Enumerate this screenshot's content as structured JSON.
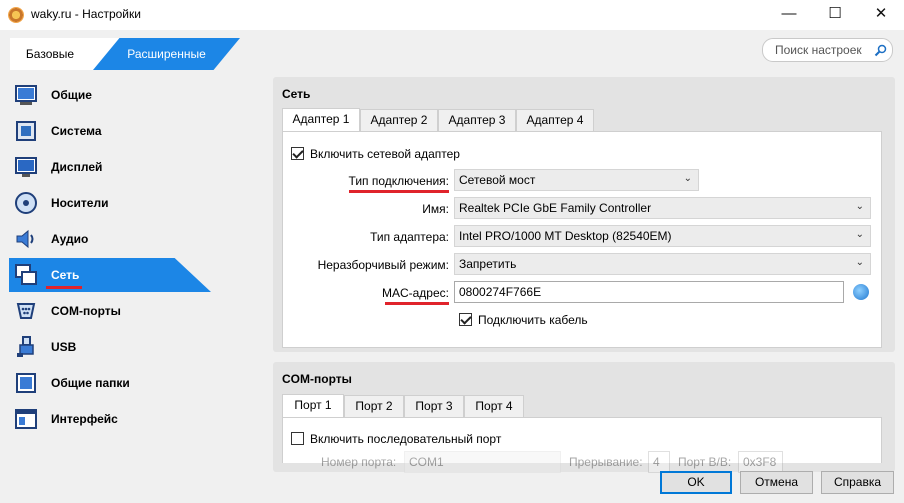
{
  "window": {
    "title": "waky.ru - Настройки",
    "controls": {
      "minimize": "—",
      "maximize": "☐",
      "close": "✕"
    }
  },
  "mode_tabs": {
    "basic": "Базовые",
    "advanced": "Расширенные",
    "active": "advanced"
  },
  "search": {
    "placeholder": "Поиск настроек",
    "icon": "search-icon"
  },
  "sidebar": {
    "items": [
      {
        "label": "Общие",
        "icon": "general-icon"
      },
      {
        "label": "Система",
        "icon": "system-icon"
      },
      {
        "label": "Дисплей",
        "icon": "display-icon"
      },
      {
        "label": "Носители",
        "icon": "storage-icon"
      },
      {
        "label": "Аудио",
        "icon": "audio-icon"
      },
      {
        "label": "Сеть",
        "icon": "network-icon",
        "active": true
      },
      {
        "label": "COM-порты",
        "icon": "serial-ports-icon"
      },
      {
        "label": "USB",
        "icon": "usb-icon"
      },
      {
        "label": "Общие папки",
        "icon": "shared-folders-icon"
      },
      {
        "label": "Интерфейс",
        "icon": "user-interface-icon"
      }
    ]
  },
  "network": {
    "title": "Сеть",
    "tabs": [
      "Адаптер 1",
      "Адаптер 2",
      "Адаптер 3",
      "Адаптер 4"
    ],
    "active_tab": 0,
    "enable_label": "Включить сетевой адаптер",
    "enable_checked": true,
    "attached_label": "Тип подключения:",
    "attached_value": "Сетевой мост",
    "name_label": "Имя:",
    "name_value": "Realtek PCIe GbE Family Controller",
    "adapter_type_label": "Тип адаптера:",
    "adapter_type_value": "Intel PRO/1000 MT Desktop (82540EM)",
    "promisc_label": "Неразборчивый режим:",
    "promisc_value": "Запретить",
    "mac_label": "MAC-адрес:",
    "mac_value": "0800274F766E",
    "cable_label": "Подключить кабель",
    "cable_checked": true
  },
  "com": {
    "title": "COM-порты",
    "tabs": [
      "Порт 1",
      "Порт 2",
      "Порт 3",
      "Порт 4"
    ],
    "active_tab": 0,
    "enable_label": "Включить последовательный порт",
    "enable_checked": false,
    "port_number_label": "Номер порта:",
    "port_number_value": "COM1",
    "irq_label": "Прерывание:",
    "irq_value": "4",
    "io_label": "Порт В/В:",
    "io_value": "0x3F8"
  },
  "buttons": {
    "ok": "OK",
    "cancel": "Отмена",
    "help": "Справка"
  },
  "colors": {
    "accent": "#1c86e6",
    "highlight_underline": "#e0232b"
  }
}
